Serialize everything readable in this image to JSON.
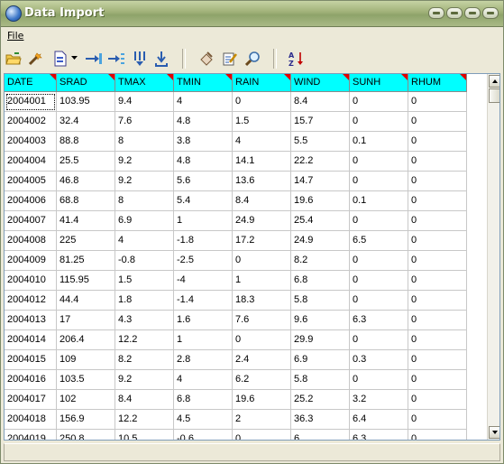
{
  "window": {
    "title": "Data Import"
  },
  "menu": {
    "file_label": "File"
  },
  "toolbar": {
    "icons": [
      "open-folder-icon",
      "wand-icon",
      "import-file-icon",
      "dropdown-arrow-icon",
      "add-column-icon",
      "insert-column-icon",
      "split-down-icon",
      "merge-icon",
      "clear-icon",
      "edit-icon",
      "find-icon",
      "sort-az-icon"
    ]
  },
  "colors": {
    "header_bg": "#00ffff",
    "header_marker": "#e00000"
  },
  "table": {
    "columns": [
      "DATE",
      "SRAD",
      "TMAX",
      "TMIN",
      "RAIN",
      "WIND",
      "SUNH",
      "RHUM"
    ],
    "rows": [
      [
        "2004001",
        "103.95",
        "9.4",
        "4",
        "0",
        "8.4",
        "0",
        "0"
      ],
      [
        "2004002",
        "32.4",
        "7.6",
        "4.8",
        "1.5",
        "15.7",
        "0",
        "0"
      ],
      [
        "2004003",
        "88.8",
        "8",
        "3.8",
        "4",
        "5.5",
        "0.1",
        "0"
      ],
      [
        "2004004",
        "25.5",
        "9.2",
        "4.8",
        "14.1",
        "22.2",
        "0",
        "0"
      ],
      [
        "2004005",
        "46.8",
        "9.2",
        "5.6",
        "13.6",
        "14.7",
        "0",
        "0"
      ],
      [
        "2004006",
        "68.8",
        "8",
        "5.4",
        "8.4",
        "19.6",
        "0.1",
        "0"
      ],
      [
        "2004007",
        "41.4",
        "6.9",
        "1",
        "24.9",
        "25.4",
        "0",
        "0"
      ],
      [
        "2004008",
        "225",
        "4",
        "-1.8",
        "17.2",
        "24.9",
        "6.5",
        "0"
      ],
      [
        "2004009",
        "81.25",
        "-0.8",
        "-2.5",
        "0",
        "8.2",
        "0",
        "0"
      ],
      [
        "2004010",
        "115.95",
        "1.5",
        "-4",
        "1",
        "6.8",
        "0",
        "0"
      ],
      [
        "2004012",
        "44.4",
        "1.8",
        "-1.4",
        "18.3",
        "5.8",
        "0",
        "0"
      ],
      [
        "2004013",
        "17",
        "4.3",
        "1.6",
        "7.6",
        "9.6",
        "6.3",
        "0"
      ],
      [
        "2004014",
        "206.4",
        "12.2",
        "1",
        "0",
        "29.9",
        "0",
        "0"
      ],
      [
        "2004015",
        "109",
        "8.2",
        "2.8",
        "2.4",
        "6.9",
        "0.3",
        "0"
      ],
      [
        "2004016",
        "103.5",
        "9.2",
        "4",
        "6.2",
        "5.8",
        "0",
        "0"
      ],
      [
        "2004017",
        "102",
        "8.4",
        "6.8",
        "19.6",
        "25.2",
        "3.2",
        "0"
      ],
      [
        "2004018",
        "156.9",
        "12.2",
        "4.5",
        "2",
        "36.3",
        "6.4",
        "0"
      ],
      [
        "2004019",
        "250.8",
        "10.5",
        "-0.6",
        "0",
        "6",
        "6.3",
        "0"
      ]
    ]
  }
}
